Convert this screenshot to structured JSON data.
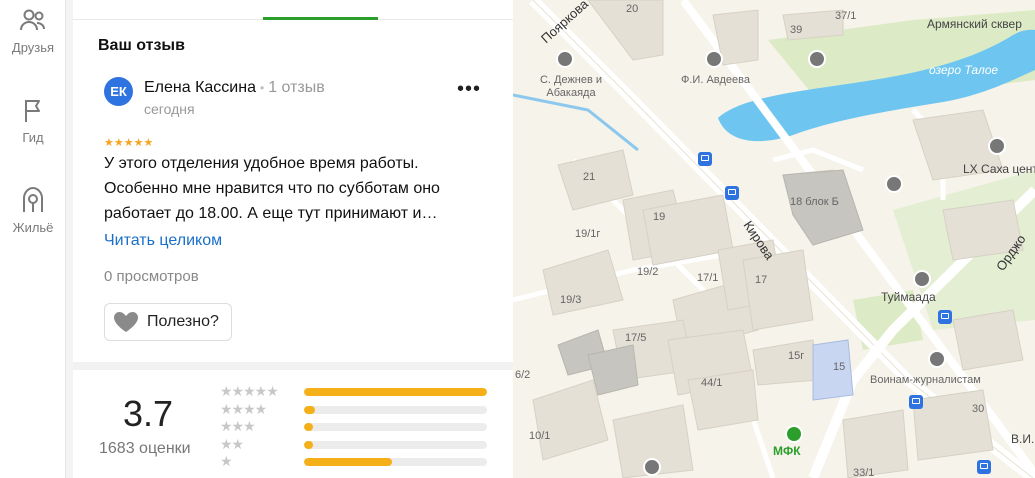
{
  "nav": {
    "items": [
      {
        "label": "Друзья",
        "icon": "friends-icon"
      },
      {
        "label": "Гид",
        "icon": "flag-icon"
      },
      {
        "label": "Жильё",
        "icon": "house-icon"
      }
    ]
  },
  "review": {
    "section_title": "Ваш отзыв",
    "author_initials": "ЕК",
    "author_name": "Елена Кассина",
    "author_reviews": "1 отзыв",
    "date": "сегодня",
    "stars": "★★★★★",
    "rating": 5,
    "text": "У этого отделения удобное время работы. Особенно мне нравится что по субботам оно работает до 18.00. А еще тут принимают и…",
    "read_more": "Читать целиком",
    "views": "0 просмотров",
    "helpful": "Полезно?"
  },
  "rating_summary": {
    "average": "3.7",
    "count_label": "1683 оценки",
    "distribution": [
      {
        "stars": "★★★★★",
        "fraction": 1.0
      },
      {
        "stars": "★★★★",
        "fraction": 0.06
      },
      {
        "stars": "★★★",
        "fraction": 0.05
      },
      {
        "stars": "★★",
        "fraction": 0.05
      },
      {
        "stars": "★",
        "fraction": 0.48
      }
    ],
    "bar_color": "#f5b019"
  },
  "map": {
    "labels": {
      "lake": "озеро Талое",
      "square": "Армянский сквер",
      "street_poyarkova": "Пояркова",
      "street_kirova": "Кирова",
      "street_ordzhonikidze": "Орджо",
      "dezhnev": "С. Дежнев и Абакаяда",
      "avdeeva": "Ф.И. Авдеева",
      "lx": "LX Саха центр",
      "tuymaada": "Туймаада",
      "voinam": "Воинам-журналистам",
      "mfk": "МФК",
      "vi": "В.И.",
      "b18": "18 блок Б",
      "n20": "20",
      "n39": "39",
      "n37": "37/1",
      "n21": "21",
      "n19": "19",
      "n19_1": "19/1г",
      "n19_2": "19/2",
      "n19_3": "19/3",
      "n17_1": "17/1",
      "n17": "17",
      "n17_5": "17/5",
      "n44": "44/1",
      "n15g": "15г",
      "n15": "15",
      "n6_2": "6/2",
      "n10_1": "10/1",
      "n30": "30",
      "n33": "33/1"
    },
    "colors": {
      "water": "#6ec6f0",
      "green": "#d9ecc4",
      "building": "#e4e0d6",
      "road": "#ffffff"
    }
  }
}
